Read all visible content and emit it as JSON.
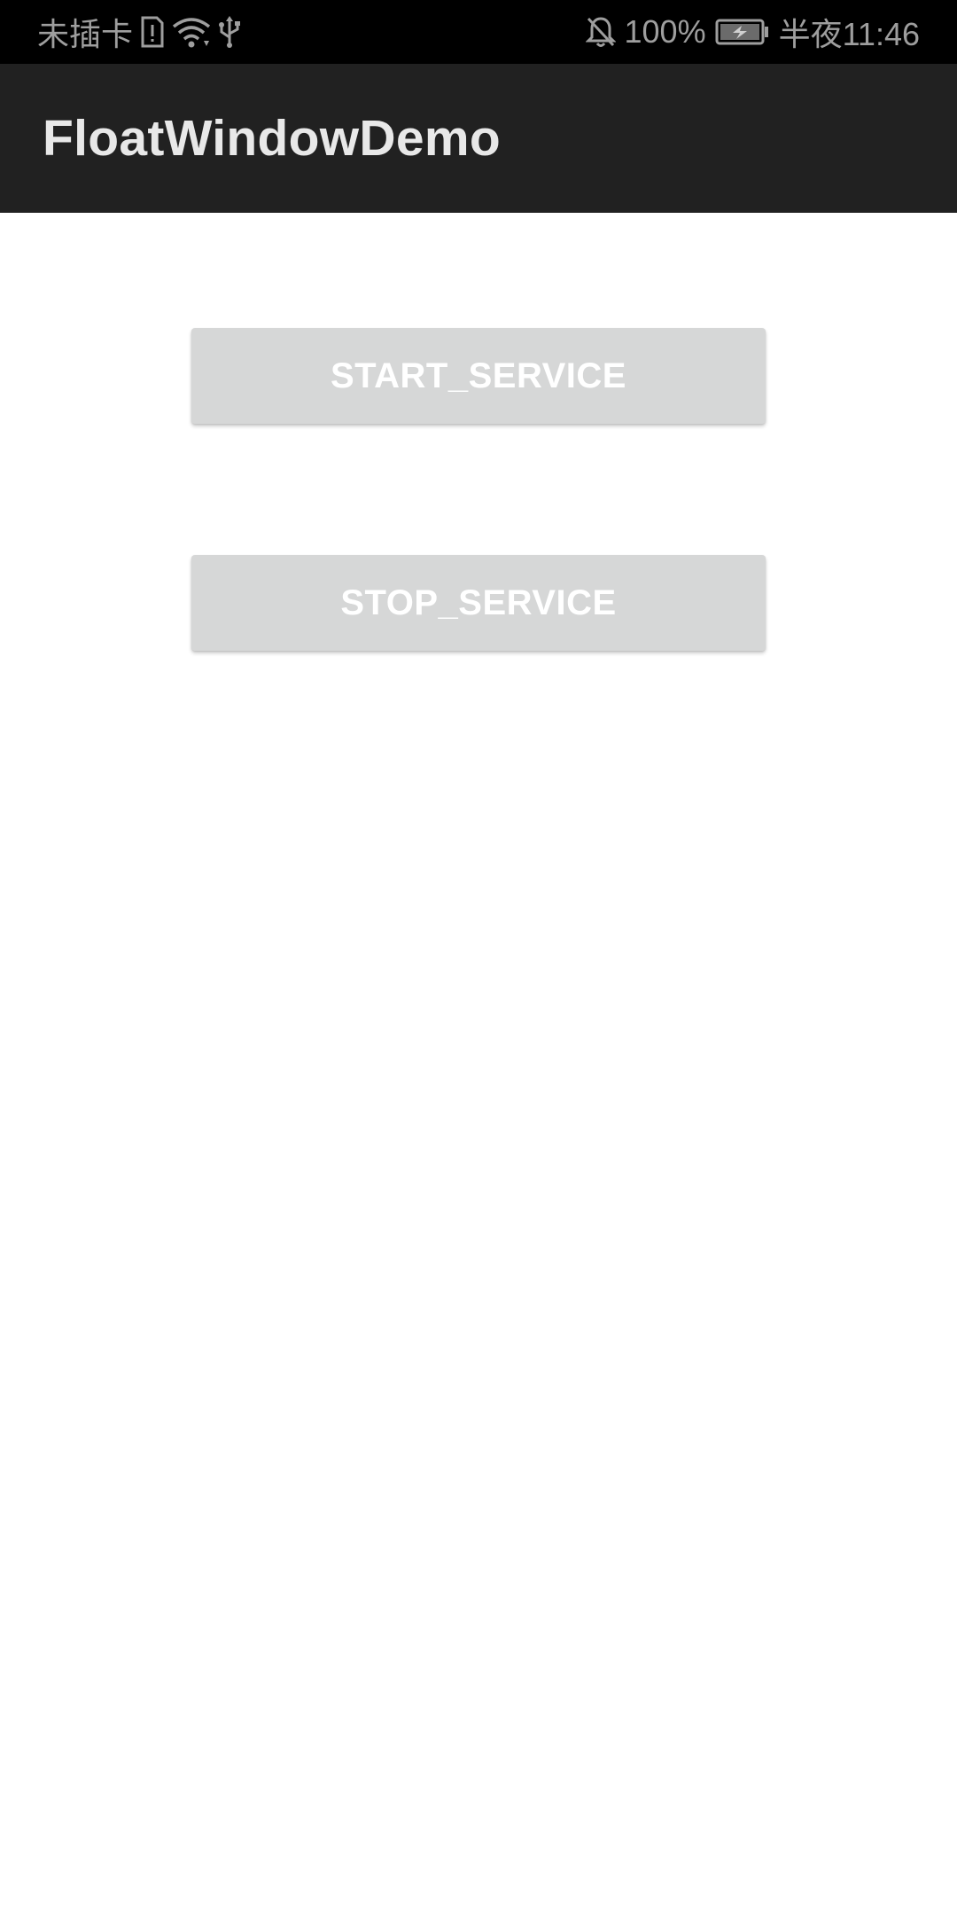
{
  "status_bar": {
    "carrier": "未插卡",
    "battery_percent": "100%",
    "time": "半夜11:46",
    "icons": [
      "sim-alert-icon",
      "wifi-icon",
      "usb-icon",
      "notifications-off-icon",
      "battery-charging-icon"
    ]
  },
  "app_bar": {
    "title": "FloatWindowDemo",
    "background_color": "#212121"
  },
  "buttons": {
    "start_label": "START_SERVICE",
    "stop_label": "STOP_SERVICE",
    "background_color": "#d6d7d7"
  }
}
